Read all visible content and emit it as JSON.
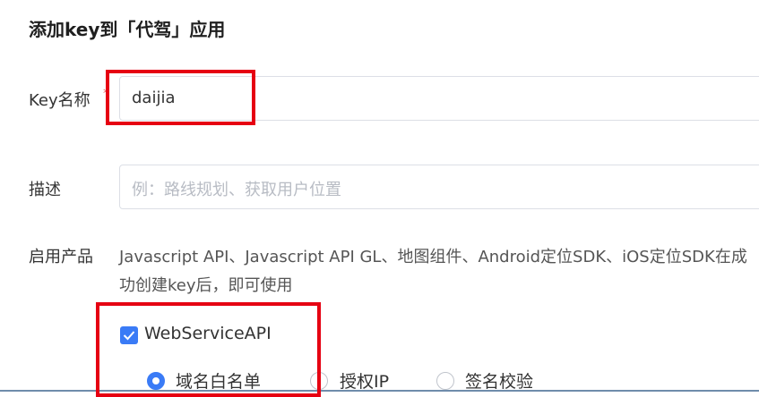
{
  "dialog": {
    "title": "添加key到「代驾」应用"
  },
  "form": {
    "key_name": {
      "label": "Key名称",
      "required_mark": "*",
      "value": "daijia"
    },
    "description": {
      "label": "描述",
      "placeholder": "例：路线规划、获取用户位置"
    },
    "products": {
      "label": "启用产品",
      "text": "Javascript API、Javascript API GL、地图组件、Android定位SDK、iOS定位SDK在成功创建key后，即可使用",
      "checkbox": {
        "label": "WebServiceAPI",
        "checked": true
      },
      "radios": [
        {
          "label": "域名白名单",
          "checked": true
        },
        {
          "label": "授权IP",
          "checked": false
        },
        {
          "label": "签名校验",
          "checked": false
        }
      ]
    }
  },
  "colors": {
    "accent": "#3a7bf6",
    "highlight_box": "#e60012",
    "required": "#e34d4d"
  }
}
